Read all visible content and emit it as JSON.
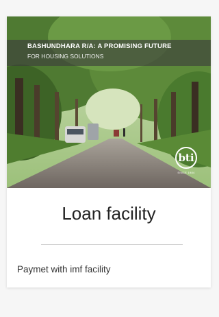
{
  "card": {
    "image": {
      "banner_title": "BASHUNDHARA R/A: A PROMISING FUTURE",
      "banner_subtitle": "FOR HOUSING SOLUTIONS",
      "logo_text": "bti",
      "logo_caption": "SINCE 1984"
    },
    "title": "Loan facility",
    "description": "Paymet with imf facility"
  },
  "colors": {
    "card_background": "#ffffff",
    "page_background": "#f6f6f6",
    "title_text": "#222222",
    "divider": "#cccccc"
  }
}
